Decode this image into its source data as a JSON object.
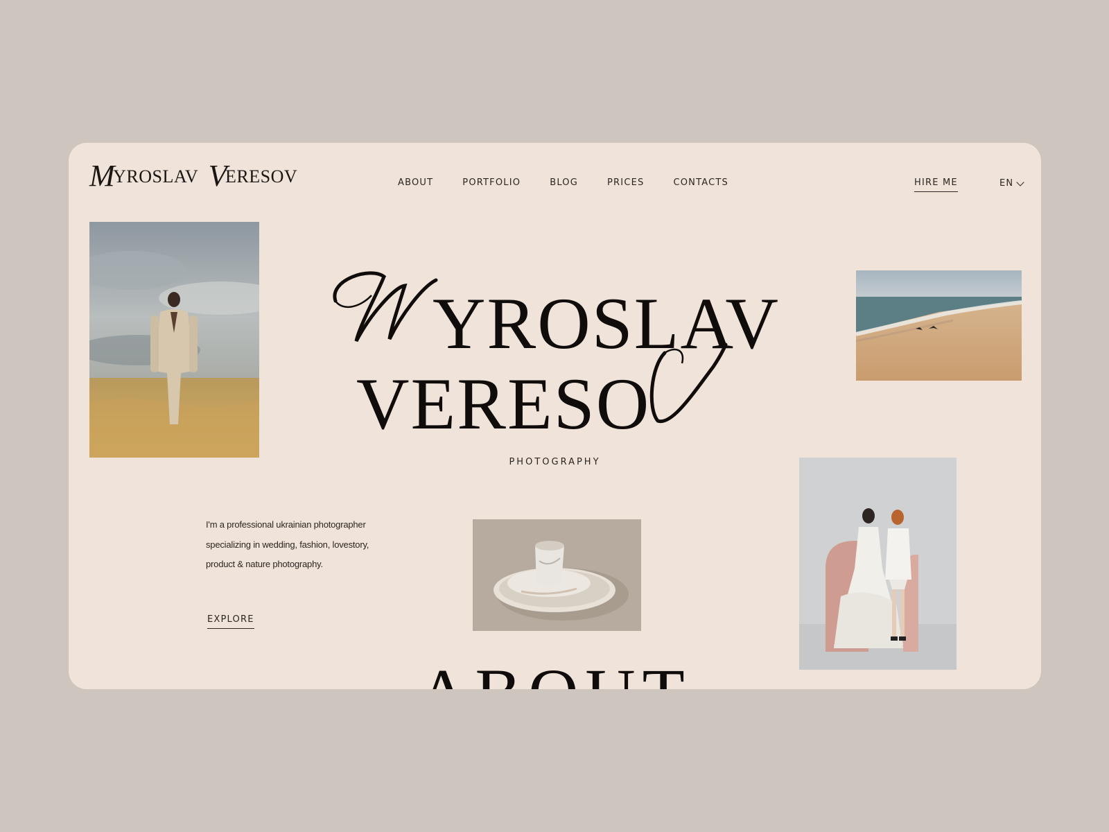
{
  "brand": {
    "logo_cap1": "M",
    "logo_rest1": "YROSLAV",
    "logo_cap2": "V",
    "logo_rest2": "ERESOV"
  },
  "nav": {
    "items": [
      "ABOUT",
      "PORTFOLIO",
      "BLOG",
      "PRICES",
      "CONTACTS"
    ]
  },
  "header": {
    "hire_label": "HIRE ME",
    "language": "EN"
  },
  "hero": {
    "line1": "YROSLAV",
    "line2": "VERESO",
    "script_initial_1": "M",
    "script_initial_2": "V",
    "subtitle": "PHOTOGRAPHY"
  },
  "intro": {
    "text": "I'm a professional ukrainian photographer specializing in wedding, fashion, lovestory, product & nature photography.",
    "cta": "EXPLORE"
  },
  "next_section": {
    "title": "ABOUT"
  },
  "colors": {
    "page_bg": "#cec5bf",
    "card_bg": "#f0e4da",
    "ink": "#0f0c0b"
  },
  "photos": [
    {
      "subject": "man-in-suit-field"
    },
    {
      "subject": "beach-with-birds"
    },
    {
      "subject": "ceramic-cup-and-plate"
    },
    {
      "subject": "two-brides-studio"
    }
  ]
}
